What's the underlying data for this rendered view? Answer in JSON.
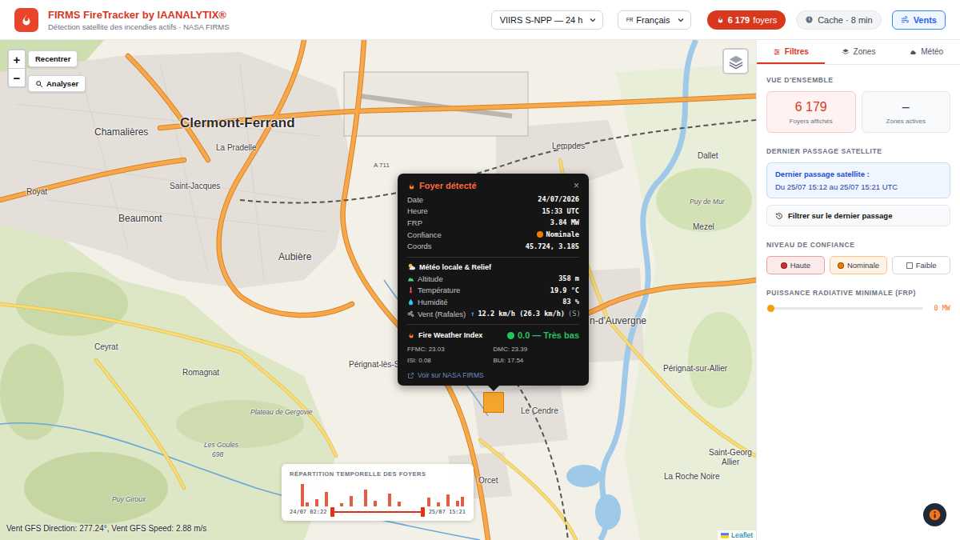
{
  "header": {
    "title": "FIRMS FireTracker by IAANALYTIX®",
    "subtitle": "Détection satellite des incendies actifs · NASA FIRMS",
    "source_select": "VIIRS S-NPP — 24 h",
    "language": {
      "flag": "FR",
      "label": "Français"
    },
    "fires_badge": {
      "count": "6 179",
      "label": "foyers"
    },
    "cache": "Cache · 8 min",
    "winds_button": "Vents"
  },
  "map": {
    "controls": {
      "zoom_in": "+",
      "zoom_out": "−",
      "recenter": "Recentrer",
      "analyze": "Analyser"
    },
    "labels": [
      {
        "text": "Clermont-Ferrand",
        "kind": "city"
      },
      {
        "text": "Chamalières",
        "kind": "town"
      },
      {
        "text": "Royat",
        "kind": "village"
      },
      {
        "text": "Saint-Jacques",
        "kind": "village"
      },
      {
        "text": "La Pradelle",
        "kind": "village"
      },
      {
        "text": "Beaumont",
        "kind": "town"
      },
      {
        "text": "Aubière",
        "kind": "town"
      },
      {
        "text": "Ceyrat",
        "kind": "village"
      },
      {
        "text": "Romagnat",
        "kind": "village"
      },
      {
        "text": "Pérignat-lès-Sarliève",
        "kind": "village"
      },
      {
        "text": "Plateau de Gergovie",
        "kind": "place"
      },
      {
        "text": "Les Goules",
        "kind": "place"
      },
      {
        "text": "698",
        "kind": "place"
      },
      {
        "text": "Puy Giroux",
        "kind": "place"
      },
      {
        "text": "Lempdes",
        "kind": "village"
      },
      {
        "text": "Dallet",
        "kind": "village"
      },
      {
        "text": "Puy de Mur",
        "kind": "place"
      },
      {
        "text": "Mezel",
        "kind": "village"
      },
      {
        "text": "n-d'Auvergne",
        "kind": "town"
      },
      {
        "text": "Pérignat-sur-Allier",
        "kind": "village"
      },
      {
        "text": "Le Cendre",
        "kind": "village"
      },
      {
        "text": "Orcet",
        "kind": "village"
      },
      {
        "text": "Saint-Georg",
        "kind": "village"
      },
      {
        "text": "Allier",
        "kind": "village"
      },
      {
        "text": "La Roche Noire",
        "kind": "village"
      },
      {
        "text": "A 711",
        "kind": "road"
      }
    ],
    "wind_status": "Vent GFS Direction: 277.24°, Vent GFS Speed: 2.88 m/s",
    "attribution": "Leaflet"
  },
  "popup": {
    "title": "Foyer détecté",
    "close": "×",
    "fields": [
      {
        "label": "Date",
        "value": "24/07/2026",
        "kind": "plain"
      },
      {
        "label": "Heure",
        "value": "15:33 UTC",
        "kind": "plain"
      },
      {
        "label": "FRP",
        "value": "3.84 MW",
        "kind": "plain"
      },
      {
        "label": "Confiance",
        "value": "Nominale",
        "kind": "dot",
        "color": "#f57c00"
      },
      {
        "label": "Coords",
        "value": "45.724, 3.185",
        "kind": "plain"
      }
    ],
    "weather": {
      "title": "Météo locale & Relief",
      "rows": [
        {
          "kind": "altitude",
          "label": "Altitude",
          "value": "358 m"
        },
        {
          "kind": "temperature",
          "label": "Température",
          "value": "19.9 °C"
        },
        {
          "kind": "humidity",
          "label": "Humidité",
          "value": "83 %"
        },
        {
          "kind": "wind",
          "label": "Vent (Rafales)",
          "arrow": "↑",
          "value": "12.2 km/h (26.3 km/h)",
          "suffix": "(S)"
        }
      ]
    },
    "fwi": {
      "title": "Fire Weather Index",
      "value": "0.0 — Très bas",
      "color": "#22c55e",
      "indices": [
        "FFMC: 23.03",
        "DMC: 23.39",
        "ISI: 0.08",
        "BUI: 17.54"
      ]
    },
    "link": "Voir sur NASA FIRMS"
  },
  "histogram": {
    "title": "RÉPARTITION TEMPORELLE DES FOYERS",
    "values": [
      46,
      8,
      0,
      14,
      0,
      30,
      0,
      0,
      6,
      0,
      22,
      0,
      0,
      34,
      0,
      12,
      0,
      0,
      26,
      0,
      10,
      0,
      0,
      0,
      0,
      0,
      18,
      0,
      8,
      0,
      24,
      0,
      12,
      20
    ],
    "start_label": "24/07 02:22",
    "end_label": "25/07 15:21",
    "range_start": 0.02,
    "range_end": 0.98
  },
  "panel": {
    "tabs": [
      {
        "label": "Filtres",
        "selected": true
      },
      {
        "label": "Zones",
        "selected": false
      },
      {
        "label": "Météo",
        "selected": false
      }
    ],
    "overview": {
      "title": "VUE D'ENSEMBLE",
      "cards": [
        {
          "value": "6 179",
          "label": "Foyers affichés",
          "kind": "highlight"
        },
        {
          "value": "–",
          "label": "Zones actives",
          "kind": "plain"
        }
      ]
    },
    "last_pass": {
      "title": "DERNIER PASSAGE SATELLITE",
      "heading": "Dernier passage satellite :",
      "range": "Du 25/07 15:12 au 25/07 15:21 UTC",
      "filter_button": "Filtrer sur le dernier passage"
    },
    "confidence": {
      "title": "NIVEAU DE CONFIANCE",
      "levels": [
        {
          "label": "Haute",
          "selected": true,
          "color": "#d32f2f"
        },
        {
          "label": "Nominale",
          "selected": true,
          "color": "#f57c00"
        },
        {
          "label": "Faible",
          "selected": false,
          "color": "#6b7280"
        }
      ]
    },
    "frp": {
      "title": "PUISSANCE RADIATIVE MINIMALE (FRP)",
      "level": 0,
      "reading": "0 MW"
    }
  }
}
